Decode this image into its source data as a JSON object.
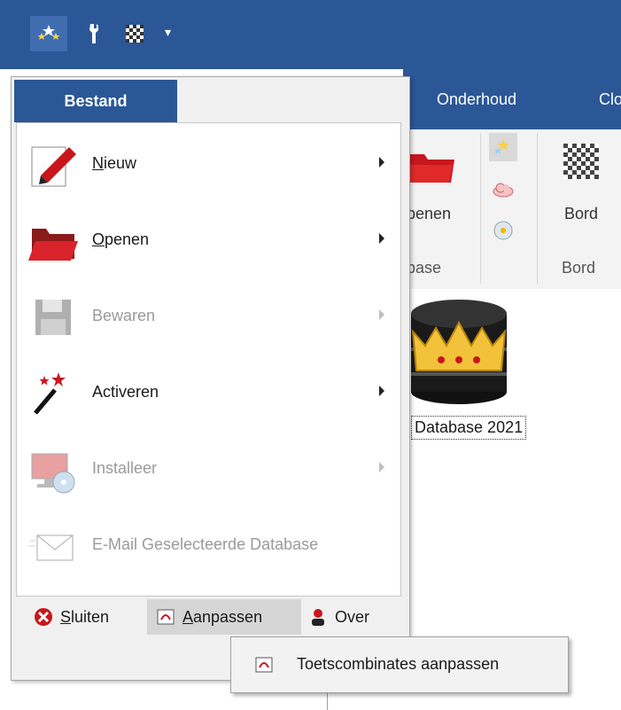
{
  "quick_access": {
    "icons": [
      "stars-app-icon",
      "wrench-icon",
      "board-icon",
      "dropdown-arrow-icon"
    ]
  },
  "ribbon": {
    "tabs": [
      "Onderhoud",
      "Clo"
    ],
    "open_label": "penen",
    "database_group_label": "base",
    "board_label": "Bord",
    "board_group_label": "Bord"
  },
  "content": {
    "database_caption": "Database 2021"
  },
  "backstage": {
    "tab_label": "Bestand",
    "items": [
      {
        "label": "Nieuw",
        "underline": "N",
        "rest": "ieuw",
        "enabled": true,
        "icon": "pen-icon"
      },
      {
        "label": "Openen",
        "underline": "O",
        "rest": "penen",
        "enabled": true,
        "icon": "folder-icon"
      },
      {
        "label": "Bewaren",
        "enabled": false,
        "icon": "save-icon"
      },
      {
        "label": "Activeren",
        "enabled": true,
        "icon": "magic-wand-icon"
      },
      {
        "label": "Installeer",
        "enabled": false,
        "icon": "install-icon"
      },
      {
        "label": "E-Mail Geselecteerde Database",
        "enabled": false,
        "icon": "email-icon"
      }
    ],
    "footer": {
      "close": {
        "u": "S",
        "rest": "luiten"
      },
      "customize": {
        "u": "A",
        "rest": "anpassen"
      },
      "about": {
        "label": "Over"
      }
    }
  },
  "popup": {
    "item_label": "Toetscombinates aanpassen"
  },
  "colors": {
    "title_bar": "#2b5797",
    "menu_bg": "#f0f0f0",
    "accent_red": "#c8161d"
  }
}
